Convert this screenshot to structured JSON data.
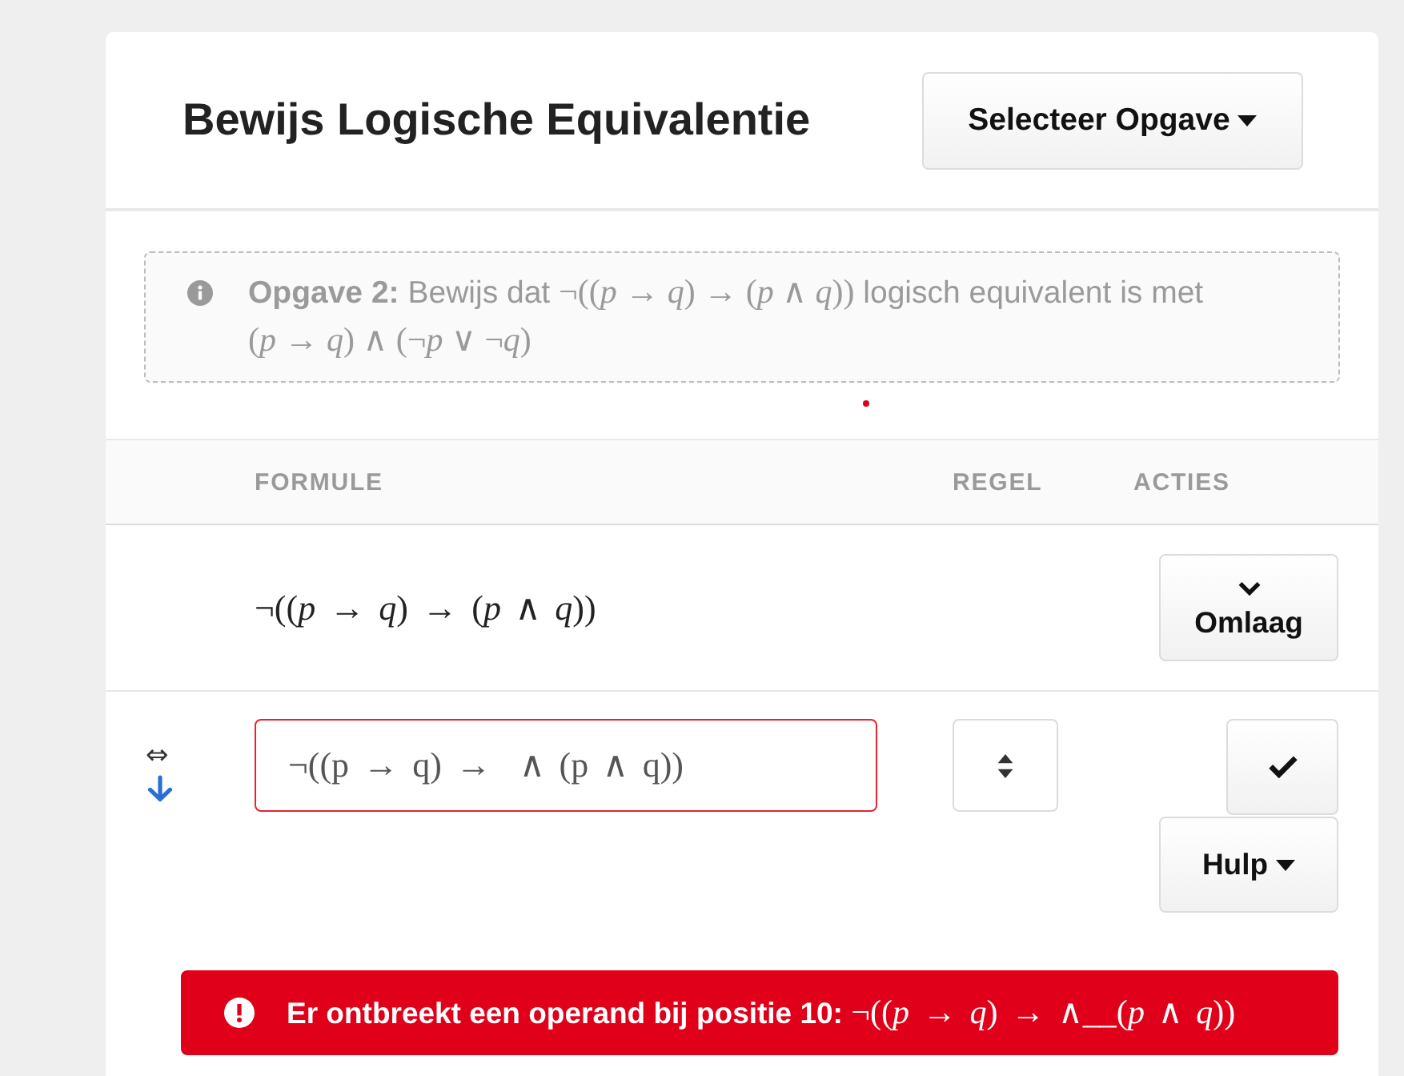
{
  "header": {
    "title": "Bewijs Logische Equivalentie",
    "menu_button": "Selecteer Opgave"
  },
  "assignment": {
    "segments": [
      {
        "kind": "text",
        "text": "**Opgave 2:** Bewijs dat"
      },
      {
        "kind": "math",
        "text": "¬((*p* → *q*) → (*p* ∧ *q*))"
      },
      {
        "kind": "text",
        "text": "logisch equivalent is met"
      },
      {
        "kind": "math",
        "text": "(*p* → *q*) ∧ (¬*p* ∨ ¬*q*)"
      }
    ]
  },
  "proof": {
    "columns": [
      "FORMULE",
      "REGEL",
      "ACTIES"
    ],
    "rows": [
      {
        "kind": "step",
        "formula": "¬((*p* → *q*) → (*p* ∧ *q*))",
        "actions": [
          {
            "kind": "down",
            "label": "Omlaag"
          }
        ]
      },
      {
        "kind": "input",
        "relation": "⇔",
        "input": {
          "value": "¬((p → q) →  ∧ (p ∧ q))",
          "invalid": true
        },
        "actions": [
          {
            "kind": "confirm"
          },
          {
            "kind": "menu",
            "label": "Hulp"
          }
        ]
      }
    ]
  },
  "alert": {
    "kind": "error",
    "message": "Er ontbreekt een operand bij positie 10:",
    "formula": "¬((*p* → *q*) → ∧__(*p* ∧ *q*))"
  }
}
